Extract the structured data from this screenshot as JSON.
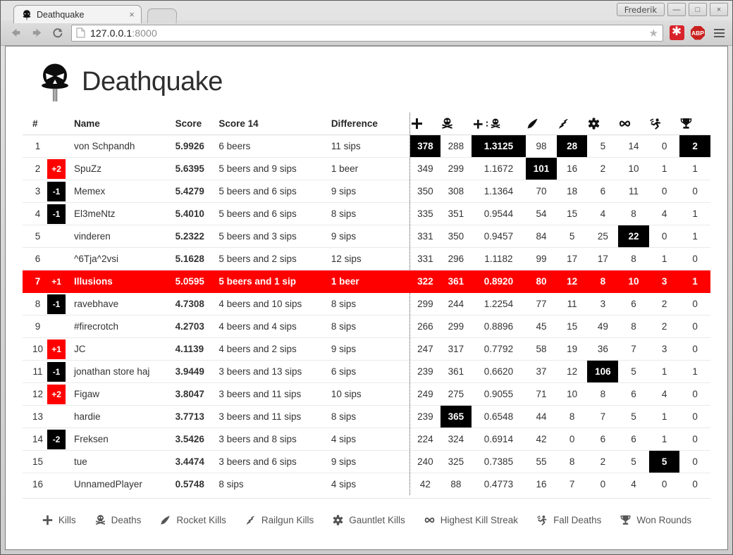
{
  "browser": {
    "tab_title": "Deathquake",
    "tab_favicon": "skull-icon",
    "close_label": "×",
    "user_label": "Frederik",
    "minimize_label": "—",
    "maximize_label": "□",
    "close_window_label": "×",
    "url_host": "127.0.0.1",
    "url_port": ":8000",
    "star_label": "★",
    "abp_label": "ABP",
    "asterisk_label": "✱"
  },
  "page": {
    "title": "Deathquake"
  },
  "table": {
    "headers": {
      "rank": "#",
      "name": "Name",
      "score": "Score",
      "score14": "Score 14",
      "difference": "Difference",
      "kills": "kills-icon",
      "deaths": "deaths-icon",
      "ratio": "kill-death-ratio-icon",
      "rocket": "rocket-icon",
      "railgun": "railgun-icon",
      "gauntlet": "gauntlet-icon",
      "streak": "infinity-icon",
      "fall": "fall-deaths-icon",
      "rounds": "trophy-icon"
    },
    "rows": [
      {
        "rank": "1",
        "badge": "",
        "badge_dir": "",
        "name": "von Schpandh",
        "score": "5.9926",
        "score14": "6 beers",
        "difference": "11 sips",
        "stats": [
          "378",
          "288",
          "1.3125",
          "98",
          "28",
          "5",
          "14",
          "0",
          "2"
        ],
        "best": [
          true,
          false,
          true,
          false,
          true,
          false,
          false,
          false,
          true
        ],
        "highlight": false
      },
      {
        "rank": "2",
        "badge": "+2",
        "badge_dir": "up",
        "name": "SpuZz",
        "score": "5.6395",
        "score14": "5 beers and 9 sips",
        "difference": "1 beer",
        "stats": [
          "349",
          "299",
          "1.1672",
          "101",
          "16",
          "2",
          "10",
          "1",
          "1"
        ],
        "best": [
          false,
          false,
          false,
          true,
          false,
          false,
          false,
          false,
          false
        ],
        "highlight": false
      },
      {
        "rank": "3",
        "badge": "-1",
        "badge_dir": "down",
        "name": "Memex",
        "score": "5.4279",
        "score14": "5 beers and 6 sips",
        "difference": "9 sips",
        "stats": [
          "350",
          "308",
          "1.1364",
          "70",
          "18",
          "6",
          "11",
          "0",
          "0"
        ],
        "best": [
          false,
          false,
          false,
          false,
          false,
          false,
          false,
          false,
          false
        ],
        "highlight": false
      },
      {
        "rank": "4",
        "badge": "-1",
        "badge_dir": "down",
        "name": "El3meNtz",
        "score": "5.4010",
        "score14": "5 beers and 6 sips",
        "difference": "8 sips",
        "stats": [
          "335",
          "351",
          "0.9544",
          "54",
          "15",
          "4",
          "8",
          "4",
          "1"
        ],
        "best": [
          false,
          false,
          false,
          false,
          false,
          false,
          false,
          false,
          false
        ],
        "highlight": false
      },
      {
        "rank": "5",
        "badge": "",
        "badge_dir": "",
        "name": "vinderen",
        "score": "5.2322",
        "score14": "5 beers and 3 sips",
        "difference": "9 sips",
        "stats": [
          "331",
          "350",
          "0.9457",
          "84",
          "5",
          "25",
          "22",
          "0",
          "1"
        ],
        "best": [
          false,
          false,
          false,
          false,
          false,
          false,
          true,
          false,
          false
        ],
        "highlight": false
      },
      {
        "rank": "6",
        "badge": "",
        "badge_dir": "",
        "name": "^6Tja^2vsi",
        "score": "5.1628",
        "score14": "5 beers and 2 sips",
        "difference": "12 sips",
        "stats": [
          "331",
          "296",
          "1.1182",
          "99",
          "17",
          "17",
          "8",
          "1",
          "0"
        ],
        "best": [
          false,
          false,
          false,
          false,
          false,
          false,
          false,
          false,
          false
        ],
        "highlight": false
      },
      {
        "rank": "7",
        "badge": "+1",
        "badge_dir": "up",
        "name": "Illusions",
        "score": "5.0595",
        "score14": "5 beers and 1 sip",
        "difference": "1 beer",
        "stats": [
          "322",
          "361",
          "0.8920",
          "80",
          "12",
          "8",
          "10",
          "3",
          "1"
        ],
        "best": [
          false,
          false,
          false,
          false,
          false,
          false,
          false,
          false,
          false
        ],
        "highlight": true
      },
      {
        "rank": "8",
        "badge": "-1",
        "badge_dir": "down",
        "name": "ravebhave",
        "score": "4.7308",
        "score14": "4 beers and 10 sips",
        "difference": "8 sips",
        "stats": [
          "299",
          "244",
          "1.2254",
          "77",
          "11",
          "3",
          "6",
          "2",
          "0"
        ],
        "best": [
          false,
          false,
          false,
          false,
          false,
          false,
          false,
          false,
          false
        ],
        "highlight": false
      },
      {
        "rank": "9",
        "badge": "",
        "badge_dir": "",
        "name": "#firecrotch",
        "score": "4.2703",
        "score14": "4 beers and 4 sips",
        "difference": "8 sips",
        "stats": [
          "266",
          "299",
          "0.8896",
          "45",
          "15",
          "49",
          "8",
          "2",
          "0"
        ],
        "best": [
          false,
          false,
          false,
          false,
          false,
          false,
          false,
          false,
          false
        ],
        "highlight": false
      },
      {
        "rank": "10",
        "badge": "+1",
        "badge_dir": "up",
        "name": "JC",
        "score": "4.1139",
        "score14": "4 beers and 2 sips",
        "difference": "9 sips",
        "stats": [
          "247",
          "317",
          "0.7792",
          "58",
          "19",
          "36",
          "7",
          "3",
          "0"
        ],
        "best": [
          false,
          false,
          false,
          false,
          false,
          false,
          false,
          false,
          false
        ],
        "highlight": false
      },
      {
        "rank": "11",
        "badge": "-1",
        "badge_dir": "down",
        "name": "jonathan store haj",
        "score": "3.9449",
        "score14": "3 beers and 13 sips",
        "difference": "6 sips",
        "stats": [
          "239",
          "361",
          "0.6620",
          "37",
          "12",
          "106",
          "5",
          "1",
          "1"
        ],
        "best": [
          false,
          false,
          false,
          false,
          false,
          true,
          false,
          false,
          false
        ],
        "highlight": false
      },
      {
        "rank": "12",
        "badge": "+2",
        "badge_dir": "up",
        "name": "Figaw",
        "score": "3.8047",
        "score14": "3 beers and 11 sips",
        "difference": "10 sips",
        "stats": [
          "249",
          "275",
          "0.9055",
          "71",
          "10",
          "8",
          "6",
          "4",
          "0"
        ],
        "best": [
          false,
          false,
          false,
          false,
          false,
          false,
          false,
          false,
          false
        ],
        "highlight": false
      },
      {
        "rank": "13",
        "badge": "",
        "badge_dir": "",
        "name": "hardie",
        "score": "3.7713",
        "score14": "3 beers and 11 sips",
        "difference": "8 sips",
        "stats": [
          "239",
          "365",
          "0.6548",
          "44",
          "8",
          "7",
          "5",
          "1",
          "0"
        ],
        "best": [
          false,
          true,
          false,
          false,
          false,
          false,
          false,
          false,
          false
        ],
        "highlight": false
      },
      {
        "rank": "14",
        "badge": "-2",
        "badge_dir": "down",
        "name": "Freksen",
        "score": "3.5426",
        "score14": "3 beers and 8 sips",
        "difference": "4 sips",
        "stats": [
          "224",
          "324",
          "0.6914",
          "42",
          "0",
          "6",
          "6",
          "1",
          "0"
        ],
        "best": [
          false,
          false,
          false,
          false,
          false,
          false,
          false,
          false,
          false
        ],
        "highlight": false
      },
      {
        "rank": "15",
        "badge": "",
        "badge_dir": "",
        "name": "tue",
        "score": "3.4474",
        "score14": "3 beers and 6 sips",
        "difference": "9 sips",
        "stats": [
          "240",
          "325",
          "0.7385",
          "55",
          "8",
          "2",
          "5",
          "5",
          "0"
        ],
        "best": [
          false,
          false,
          false,
          false,
          false,
          false,
          false,
          true,
          false
        ],
        "highlight": false
      },
      {
        "rank": "16",
        "badge": "",
        "badge_dir": "",
        "name": "UnnamedPlayer",
        "score": "0.5748",
        "score14": "8 sips",
        "difference": "4 sips",
        "stats": [
          "42",
          "88",
          "0.4773",
          "16",
          "7",
          "0",
          "4",
          "0",
          "0"
        ],
        "best": [
          false,
          false,
          false,
          false,
          false,
          false,
          false,
          false,
          false
        ],
        "highlight": false
      }
    ]
  },
  "legend": [
    {
      "icon": "kills-icon",
      "label": "Kills"
    },
    {
      "icon": "deaths-icon",
      "label": "Deaths"
    },
    {
      "icon": "rocket-icon",
      "label": "Rocket Kills"
    },
    {
      "icon": "railgun-icon",
      "label": "Railgun Kills"
    },
    {
      "icon": "gauntlet-icon",
      "label": "Gauntlet Kills"
    },
    {
      "icon": "infinity-icon",
      "label": "Highest Kill Streak"
    },
    {
      "icon": "fall-deaths-icon",
      "label": "Fall Deaths"
    },
    {
      "icon": "trophy-icon",
      "label": "Won Rounds"
    }
  ],
  "colors": {
    "accent_red": "#fe0000",
    "best_bg": "#000000",
    "text": "#333333"
  }
}
